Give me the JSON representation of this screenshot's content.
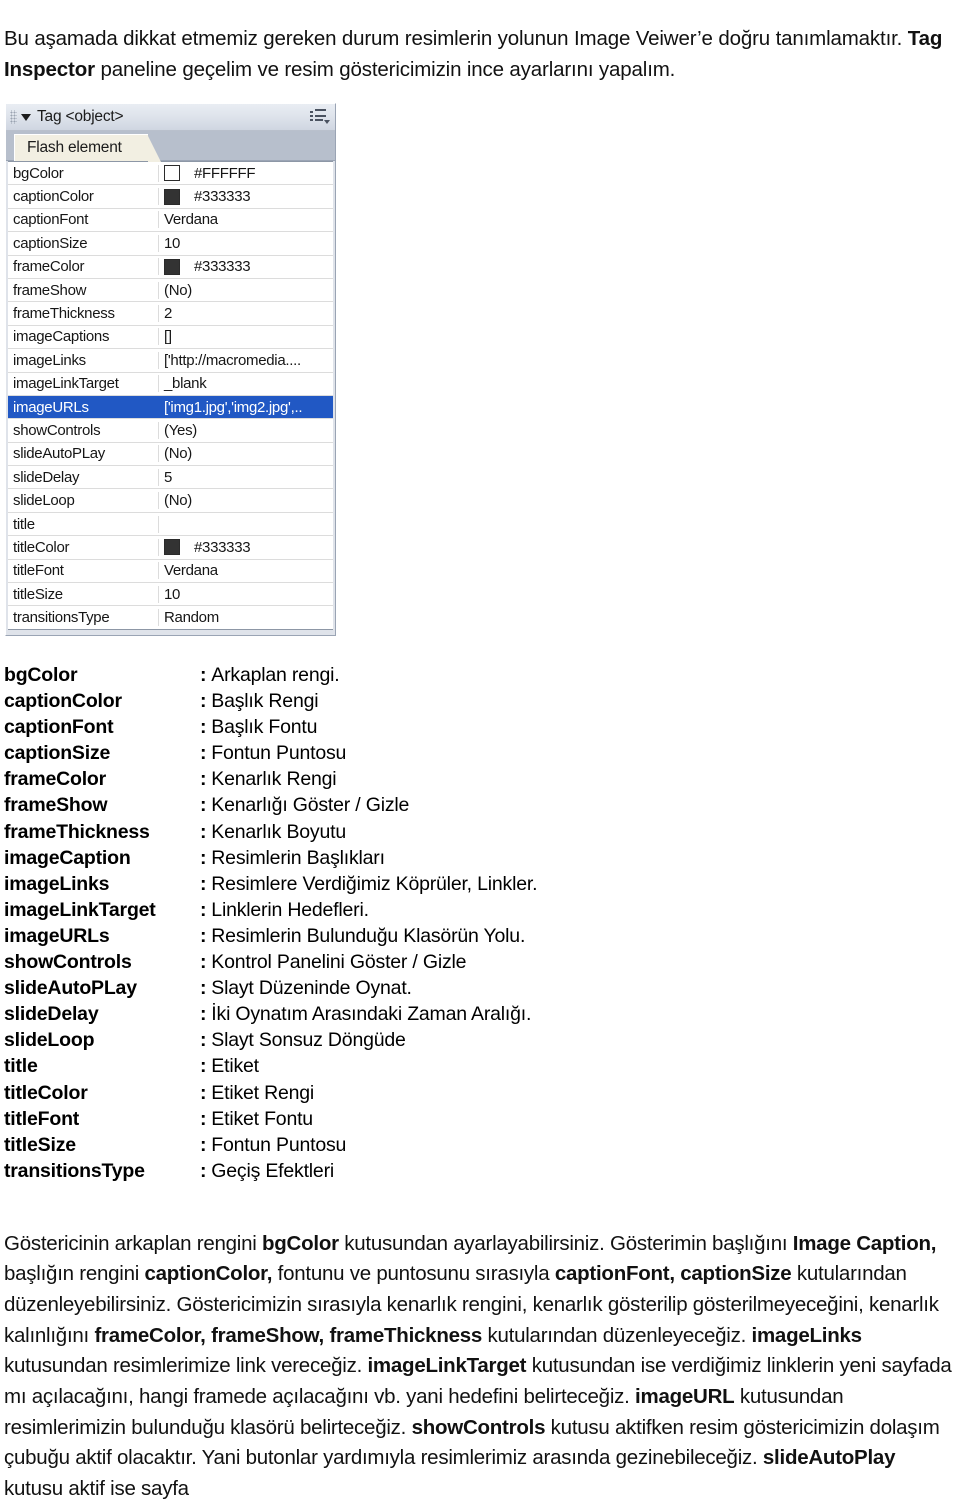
{
  "intro": {
    "part1": "Bu aşamada dikkat etmemiz gereken durum resimlerin yolunun Image Veiwer’e doğru tanımlamaktır. ",
    "bold1": "Tag Inspector",
    "part2": " paneline geçelim ve resim göstericimizin ince ayarlarını yapalım."
  },
  "panel": {
    "grip_icon": "drag-grip-icon",
    "collapse_icon": "triangle-down-icon",
    "title": "Tag <object>",
    "menu_icon": "panel-options-menu-icon",
    "tab_label": "Flash element",
    "rows": [
      {
        "name": "bgColor",
        "value": "#FFFFFF",
        "swatch": "#FFFFFF",
        "selected": false
      },
      {
        "name": "captionColor",
        "value": "#333333",
        "swatch": "#333333",
        "selected": false
      },
      {
        "name": "captionFont",
        "value": "Verdana",
        "swatch": null,
        "selected": false
      },
      {
        "name": "captionSize",
        "value": "10",
        "swatch": null,
        "selected": false
      },
      {
        "name": "frameColor",
        "value": "#333333",
        "swatch": "#333333",
        "selected": false
      },
      {
        "name": "frameShow",
        "value": "(No)",
        "swatch": null,
        "selected": false
      },
      {
        "name": "frameThickness",
        "value": "2",
        "swatch": null,
        "selected": false
      },
      {
        "name": "imageCaptions",
        "value": "[]",
        "swatch": null,
        "selected": false
      },
      {
        "name": "imageLinks",
        "value": "['http://macromedia....",
        "swatch": null,
        "selected": false
      },
      {
        "name": "imageLinkTarget",
        "value": "_blank",
        "swatch": null,
        "selected": false
      },
      {
        "name": "imageURLs",
        "value": "['img1.jpg','img2.jpg',..",
        "swatch": null,
        "selected": true
      },
      {
        "name": "showControls",
        "value": "(Yes)",
        "swatch": null,
        "selected": false
      },
      {
        "name": "slideAutoPLay",
        "value": "(No)",
        "swatch": null,
        "selected": false
      },
      {
        "name": "slideDelay",
        "value": "5",
        "swatch": null,
        "selected": false
      },
      {
        "name": "slideLoop",
        "value": "(No)",
        "swatch": null,
        "selected": false
      },
      {
        "name": "title",
        "value": "",
        "swatch": null,
        "selected": false
      },
      {
        "name": "titleColor",
        "value": "#333333",
        "swatch": "#333333",
        "selected": false
      },
      {
        "name": "titleFont",
        "value": "Verdana",
        "swatch": null,
        "selected": false
      },
      {
        "name": "titleSize",
        "value": "10",
        "swatch": null,
        "selected": false
      },
      {
        "name": "transitionsType",
        "value": "Random",
        "swatch": null,
        "selected": false
      }
    ]
  },
  "definitions": {
    "separator": ":",
    "items": [
      {
        "term": "bgColor",
        "desc": "Arkaplan rengi."
      },
      {
        "term": "captionColor",
        "desc": "Başlık Rengi"
      },
      {
        "term": "captionFont",
        "desc": "Başlık Fontu"
      },
      {
        "term": "captionSize",
        "desc": "Fontun Puntosu"
      },
      {
        "term": "frameColor",
        "desc": "Kenarlık Rengi"
      },
      {
        "term": "frameShow",
        "desc": "Kenarlığı Göster / Gizle"
      },
      {
        "term": "frameThickness",
        "desc": "Kenarlık Boyutu"
      },
      {
        "term": "imageCaption",
        "desc": "Resimlerin Başlıkları"
      },
      {
        "term": "imageLinks",
        "desc": "Resimlere Verdiğimiz Köprüler, Linkler."
      },
      {
        "term": "imageLinkTarget",
        "desc": "Linklerin Hedefleri."
      },
      {
        "term": "imageURLs",
        "desc": "Resimlerin Bulunduğu Klasörün Yolu."
      },
      {
        "term": "showControls",
        "desc": "Kontrol Panelini Göster / Gizle"
      },
      {
        "term": "slideAutoPLay",
        "desc": "Slayt Düzeninde Oynat."
      },
      {
        "term": "slideDelay",
        "desc": "İki Oynatım Arasındaki Zaman Aralığı."
      },
      {
        "term": "slideLoop",
        "desc": "Slayt Sonsuz Döngüde"
      },
      {
        "term": "title",
        "desc": "Etiket"
      },
      {
        "term": "titleColor",
        "desc": "Etiket Rengi"
      },
      {
        "term": "titleFont",
        "desc": "Etiket Fontu"
      },
      {
        "term": "titleSize",
        "desc": "Fontun Puntosu"
      },
      {
        "term": "transitionsType",
        "desc": "Geçiş Efektleri"
      }
    ]
  },
  "outro": {
    "s1": "Göstericinin arkaplan rengini ",
    "b1": "bgColor",
    "s2": " kutusundan ayarlayabilirsiniz. Gösterimin başlığını ",
    "b2": "Image Caption,",
    "s3": " başlığın rengini ",
    "b3": "captionColor,",
    "s4": " fontunu ve puntosunu sırasıyla ",
    "b4": "captionFont, captionSize",
    "s5": " kutularından düzenleyebilirsiniz. Göstericimizin sırasıyla kenarlık rengini, kenarlık gösterilip gösterilmeyeceğini, kenarlık kalınlığını ",
    "b5": "frameColor, frameShow, frameThickness",
    "s6": " kutularından düzenleyeceğiz. ",
    "b6": "imageLinks",
    "s7": " kutusundan resimlerimize link vereceğiz. ",
    "b7": "imageLinkTarget",
    "s8": " kutusundan ise verdiğimiz linklerin yeni sayfada mı açılacağını, hangi framede açılacağını vb. yani hedefini belirteceğiz. ",
    "b8": "imageURL",
    "s9": " kutusundan resimlerimizin bulunduğu klasörü belirteceğiz. ",
    "b9": "showControls",
    "s10": " kutusu aktifken resim göstericimizin dolaşım çubuğu aktif olacaktır. Yani butonlar yardımıyla resimlerimiz arasında gezinebileceğiz. ",
    "b10": "slideAutoPlay",
    "s11": " kutusu aktif ise sayfa"
  },
  "colors": {
    "selection_blue": "#2158c4",
    "panel_chrome": "#dfe3ea",
    "tab_active": "#f2efe2",
    "tabstrip": "#b7bfcc"
  }
}
